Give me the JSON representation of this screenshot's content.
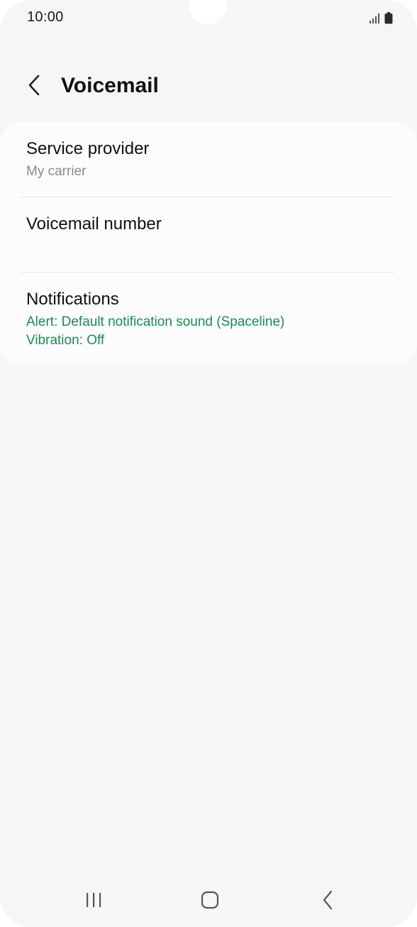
{
  "status_bar": {
    "time": "10:00",
    "icons": [
      "signal-icon",
      "battery-icon"
    ]
  },
  "header": {
    "back_icon": "chevron-left-icon",
    "title": "Voicemail"
  },
  "settings": {
    "items": [
      {
        "title": "Service provider",
        "subtitle": "My carrier"
      },
      {
        "title": "Voicemail number",
        "subtitle": ""
      },
      {
        "title": "Notifications",
        "lines": [
          "Alert: Default notification sound (Spaceline)",
          "Vibration: Off"
        ]
      }
    ]
  },
  "nav_bar": {
    "buttons": [
      "recent-apps-icon",
      "home-icon",
      "back-icon"
    ]
  },
  "colors": {
    "background": "#f6f6f8",
    "card": "#fcfcfe",
    "accent_green": "#1a8a55",
    "secondary_text": "#8a8a8a"
  }
}
